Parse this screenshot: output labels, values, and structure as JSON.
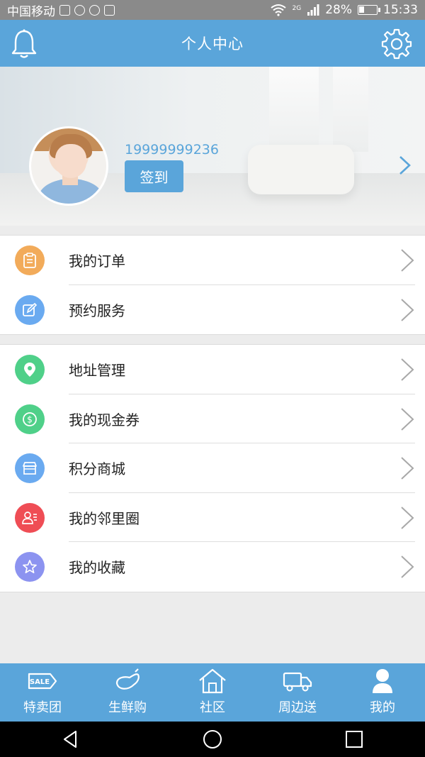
{
  "status_bar": {
    "carrier": "中国移动",
    "network": "2G",
    "battery": "28%",
    "time": "15:33"
  },
  "header": {
    "title": "个人中心",
    "left_icon": "bell-icon",
    "right_icon": "gear-icon"
  },
  "profile": {
    "phone": "19999999236",
    "checkin_label": "签到"
  },
  "menu_group_1": [
    {
      "label": "我的订单",
      "icon": "clipboard-icon",
      "color": "#f2ab5a"
    },
    {
      "label": "预约服务",
      "icon": "edit-icon",
      "color": "#6aaaf0"
    }
  ],
  "menu_group_2": [
    {
      "label": "地址管理",
      "icon": "location-pin-icon",
      "color": "#4fd089"
    },
    {
      "label": "我的现金券",
      "icon": "dollar-coin-icon",
      "color": "#4fd089"
    },
    {
      "label": "积分商城",
      "icon": "store-icon",
      "color": "#6aaaf0"
    },
    {
      "label": "我的邻里圈",
      "icon": "contacts-icon",
      "color": "#ef4d55"
    },
    {
      "label": "我的收藏",
      "icon": "star-icon",
      "color": "#8c93f0"
    }
  ],
  "tabbar": [
    {
      "label": "特卖团",
      "icon": "sale-tag-icon",
      "active": false
    },
    {
      "label": "生鲜购",
      "icon": "eggplant-icon",
      "active": false
    },
    {
      "label": "社区",
      "icon": "house-icon",
      "active": false
    },
    {
      "label": "周边送",
      "icon": "truck-icon",
      "active": false
    },
    {
      "label": "我的",
      "icon": "person-icon",
      "active": true
    }
  ],
  "colors": {
    "primary": "#5aa5da",
    "background": "#ececec"
  }
}
